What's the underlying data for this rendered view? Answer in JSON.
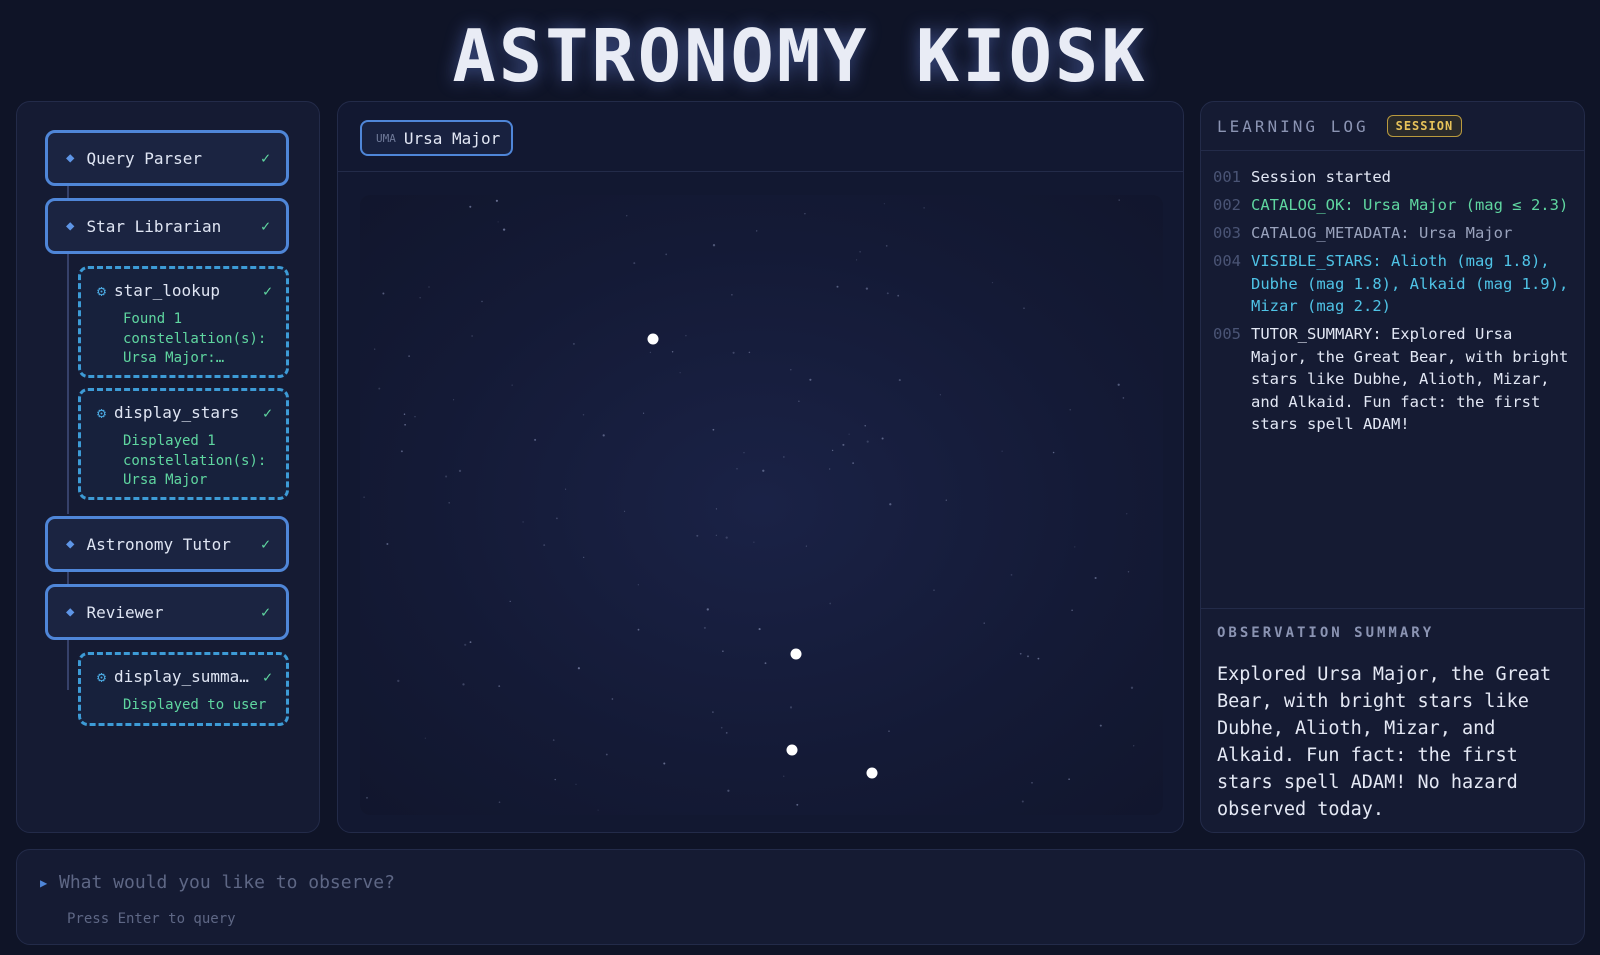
{
  "app": {
    "title": "ASTRONOMY KIOSK"
  },
  "pipeline": {
    "agents": [
      {
        "name": "Query Parser",
        "status": "✓"
      },
      {
        "name": "Star Librarian",
        "status": "✓"
      },
      {
        "name": "Astronomy Tutor",
        "status": "✓"
      },
      {
        "name": "Reviewer",
        "status": "✓"
      }
    ],
    "tools": [
      {
        "name": "star_lookup",
        "status": "✓",
        "result": "Found 1\nconstellation(s):\nUrsa Major:…"
      },
      {
        "name": "display_stars",
        "status": "✓",
        "result": "Displayed 1\nconstellation(s):\nUrsa Major"
      },
      {
        "name": "display_summa…",
        "status": "✓",
        "result": "Displayed to user"
      }
    ],
    "icons": {
      "agent": "diamond-icon",
      "tool": "gear-icon",
      "done": "check-icon"
    }
  },
  "star_map": {
    "tab": {
      "abbr": "UMA",
      "name": "Ursa Major"
    }
  },
  "log": {
    "title": "LEARNING LOG",
    "badge": "SESSION",
    "entries": [
      {
        "num": "001",
        "text": "Session started",
        "color": "#e2e7f4"
      },
      {
        "num": "002",
        "text": "CATALOG_OK: Ursa Major (mag ≤ 2.3)",
        "color": "#5fd6a0"
      },
      {
        "num": "003",
        "text": "CATALOG_METADATA: Ursa Major",
        "color": "#9aa3bd"
      },
      {
        "num": "004",
        "text": "VISIBLE_STARS: Alioth (mag 1.8),\nDubhe (mag 1.8), Alkaid (mag 1.9),\nMizar (mag 2.2)",
        "color": "#4fc3e6"
      },
      {
        "num": "005",
        "text": "TUTOR_SUMMARY: Explored Ursa\nMajor, the Great Bear, with bright\nstars like Dubhe, Alioth, Mizar,\nand Alkaid. Fun fact: the first\nstars spell ADAM!",
        "color": "#e2e7f4"
      }
    ]
  },
  "observation": {
    "title": "OBSERVATION SUMMARY",
    "text": "Explored Ursa Major, the Great Bear, with bright stars like Dubhe, Alioth, Mizar, and Alkaid. Fun fact: the first stars spell ADAM! No hazard observed today."
  },
  "query": {
    "placeholder": "What would you like to observe?",
    "value": "",
    "hint": "Press Enter to query"
  },
  "colors": {
    "accent": "#4f86d8",
    "success": "#5fd6a0",
    "badge": "#e7c25a",
    "background": "#0f1427"
  }
}
